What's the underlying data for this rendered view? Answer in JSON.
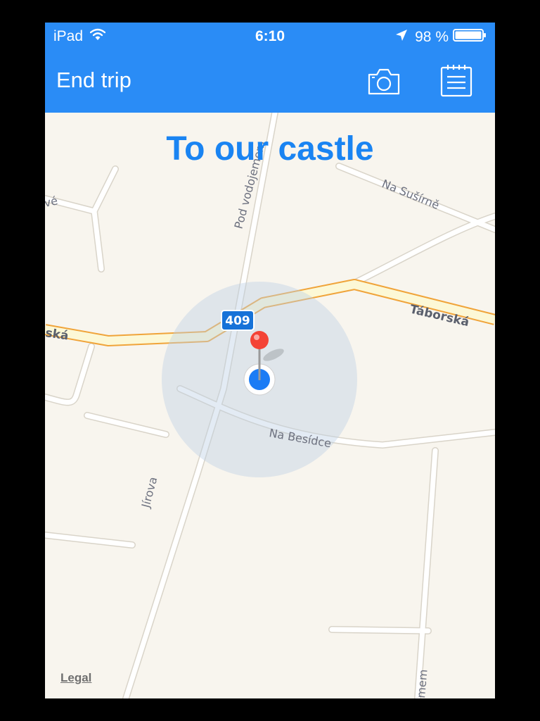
{
  "status_bar": {
    "device": "iPad",
    "time": "6:10",
    "battery": "98 %",
    "icons": [
      "wifi-icon",
      "location-arrow-icon",
      "battery-icon"
    ]
  },
  "nav_bar": {
    "end_trip_label": "End trip",
    "icons": [
      "camera-icon",
      "notepad-icon"
    ]
  },
  "trip_title": "To our castle",
  "map": {
    "route_badge": "409",
    "streets": {
      "taborska": "Táborská",
      "taborska_left": "ská",
      "na_susirne": "Na Sušírně",
      "pod_vodojemem": "Pod vodojemem",
      "na_besidce": "Na Besídce",
      "jirova": "Jírova",
      "left_partial": "vé",
      "bottom_right_partial": "mem"
    },
    "legal_label": "Legal"
  },
  "colors": {
    "accent": "#2a8cf6",
    "title": "#1a84f2",
    "map_background": "#f8f5ee",
    "major_road": "#fcf8d6",
    "major_road_border": "#f0a43a",
    "pin": "#f44336",
    "location_dot": "#1b7cf5"
  }
}
